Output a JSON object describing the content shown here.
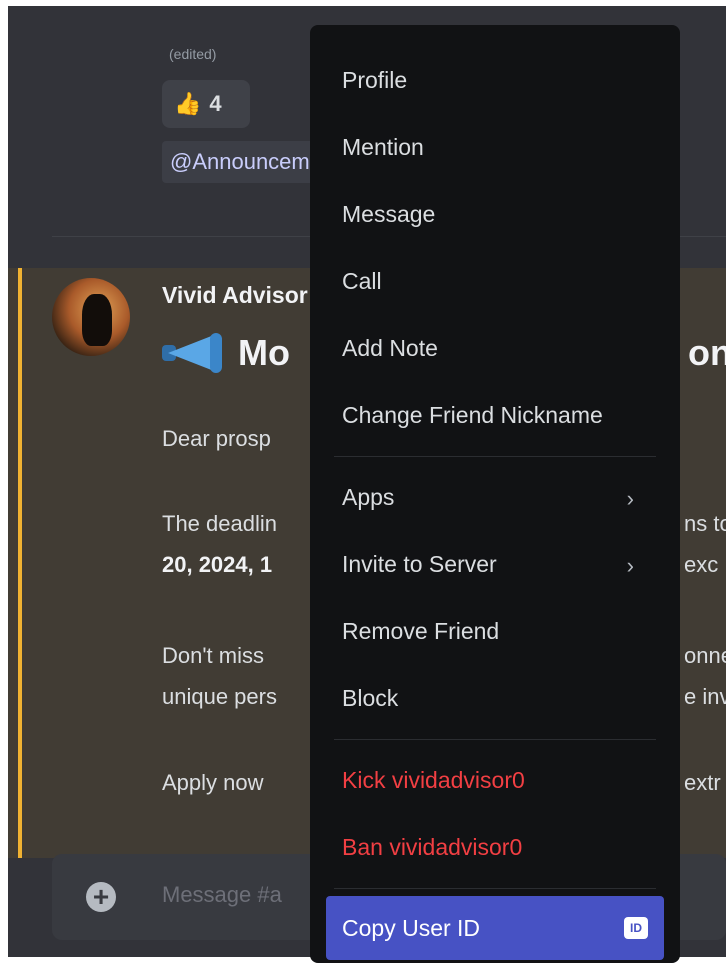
{
  "previous_message": {
    "edited_label": "(edited)",
    "reaction": {
      "emoji": "👍",
      "count": "4"
    },
    "mention_chip": "@Announcements"
  },
  "message": {
    "author": "Vivid Advisor",
    "heading_start": "Mo",
    "heading_tail": "on",
    "lines": [
      {
        "left": "Dear prosp",
        "right": ""
      },
      {
        "left": "The deadlin",
        "right": "ns to"
      },
      {
        "left": "20, 2024, 1",
        "right": "exc"
      },
      {
        "left": "Don't miss",
        "right": "onne"
      },
      {
        "left": "unique pers",
        "right": "e inv"
      },
      {
        "left": "Apply now",
        "right": "extr"
      }
    ]
  },
  "composer": {
    "placeholder": "Message #a"
  },
  "context_menu": {
    "items_group1": [
      "Profile",
      "Mention",
      "Message",
      "Call",
      "Add Note",
      "Change Friend Nickname"
    ],
    "items_group2": [
      "Apps",
      "Invite to Server",
      "Remove Friend",
      "Block"
    ],
    "items_danger": [
      "Kick vividadvisor0",
      "Ban vividadvisor0"
    ],
    "copy_id": "Copy User ID",
    "id_badge": "ID"
  },
  "colors": {
    "menu_bg": "#111214",
    "danger": "#f23f43",
    "active": "#4752c4",
    "highlight_bar": "#f0b232"
  }
}
